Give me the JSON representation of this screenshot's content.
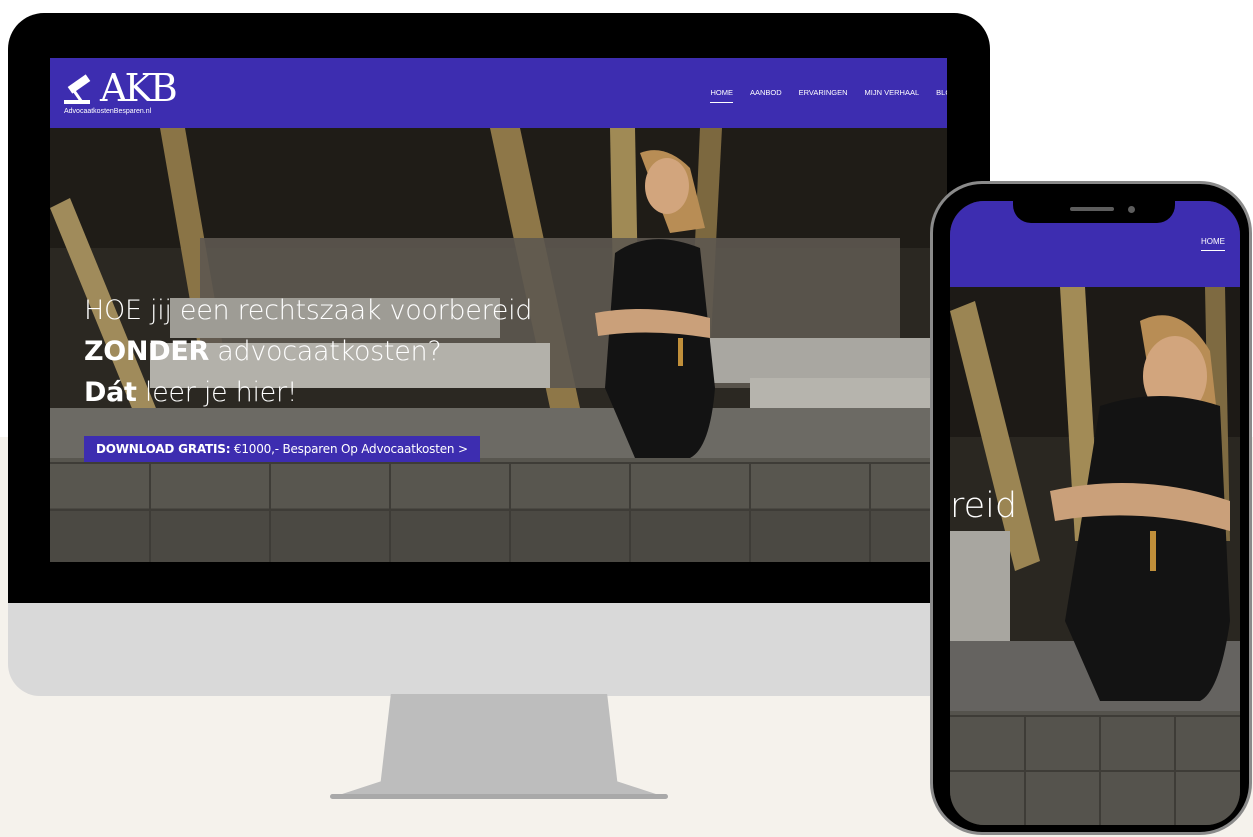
{
  "desktop": {
    "logo": {
      "text": "AKB",
      "subtitle": "AdvocaatkostenBesparen.nl"
    },
    "nav": [
      "HOME",
      "AANBOD",
      "ERVARINGEN",
      "MIJN VERHAAL",
      "BLOG"
    ],
    "active_nav": "HOME",
    "hero": {
      "line1": "HOE jij een rechtszaak voorbereid",
      "line2_bold": "ZONDER",
      "line2_rest": " advocaatkosten?",
      "line3_bold": "Dát",
      "line3_rest": " leer je hier!"
    },
    "cta": {
      "bold": "DOWNLOAD GRATIS:",
      "rest": " €1000,- Besparen Op Advocaatkosten >"
    }
  },
  "phone": {
    "nav_item": "HOME",
    "hero_fragment": "reid"
  },
  "colors": {
    "brand": "#3d2db0",
    "bezel": "#000000",
    "chin": "#d9d9d9",
    "stand": "#bdbdbd",
    "backdrop": "#f5f2ec"
  }
}
